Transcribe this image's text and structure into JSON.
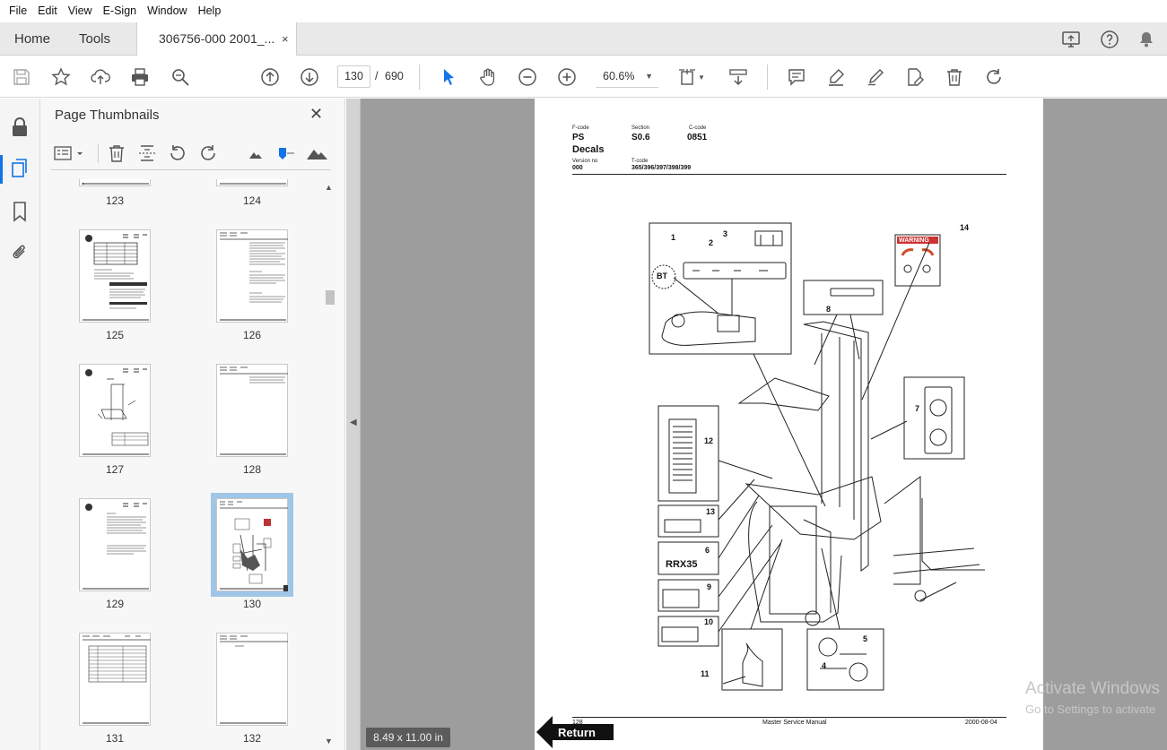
{
  "menu": [
    "File",
    "Edit",
    "View",
    "E-Sign",
    "Window",
    "Help"
  ],
  "tabs": {
    "home": "Home",
    "tools": "Tools",
    "document": "306756-000 2001_...",
    "close": "×"
  },
  "toolbar": {
    "page_current": "130",
    "page_sep": "/",
    "page_total": "690",
    "zoom": "60.6%"
  },
  "panel": {
    "title": "Page Thumbnails",
    "close": "✕",
    "thumbnails": [
      "123",
      "124",
      "125",
      "126",
      "127",
      "128",
      "129",
      "130",
      "131",
      "132"
    ],
    "selected": "130"
  },
  "document": {
    "header": {
      "fcode_label": "F-code",
      "fcode_value": "PS",
      "section_label": "Section",
      "section_value": "S0.6",
      "ccode_label": "C-code",
      "ccode_value": "0851",
      "title": "Decals",
      "version_label": "Version no",
      "version_value": "000",
      "tcode_label": "T-code",
      "tcode_value": "365/396/397/398/399"
    },
    "callouts": [
      "1",
      "2",
      "3",
      "4",
      "5",
      "6",
      "7",
      "8",
      "9",
      "10",
      "11",
      "12",
      "13",
      "14"
    ],
    "decal_texts": {
      "warning": "WARNING",
      "model": "RRX35",
      "bt": "BT"
    },
    "footer": {
      "page": "128",
      "title": "Master Service Manual",
      "date": "2000-08-04"
    },
    "page_size": "8.49 x 11.00 in",
    "return_label": "Return"
  },
  "watermark": {
    "line1": "Activate Windows",
    "line2": "Go to Settings to activate"
  }
}
